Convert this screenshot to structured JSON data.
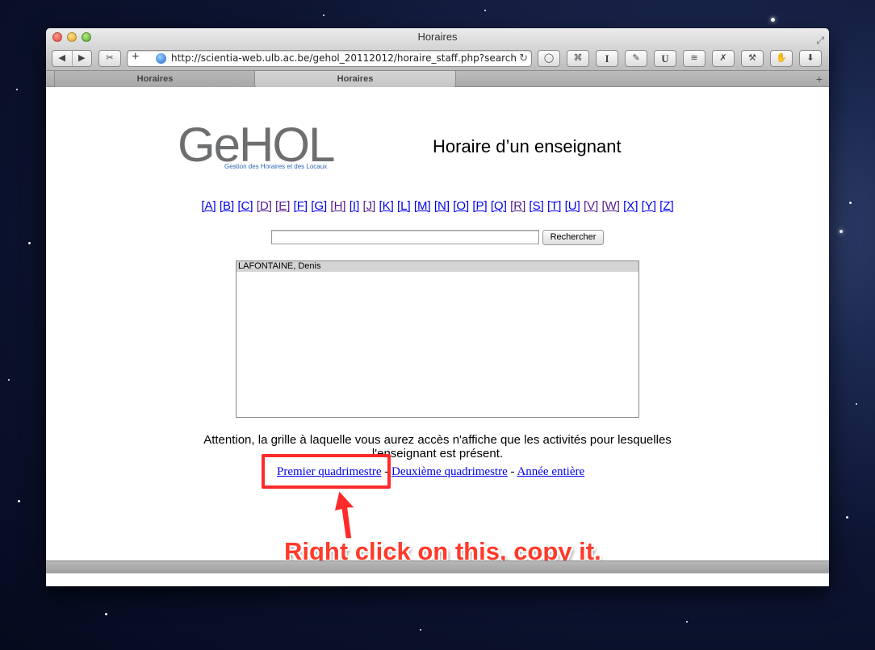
{
  "window": {
    "title": "Horaires"
  },
  "toolbar": {
    "url": "http://scientia-web.ulb.ac.be/gehol_20112012/horaire_staff.php?search",
    "extension_buttons": [
      "O",
      "rss",
      "I",
      "css",
      "U",
      "w",
      "x",
      "t",
      "h",
      "d"
    ]
  },
  "tabs": [
    {
      "label": "Horaires",
      "active": false
    },
    {
      "label": "Horaires",
      "active": true
    }
  ],
  "page": {
    "logo": {
      "word": "GeHOL",
      "subtitle": "Gestion des Horaires et des Locaux"
    },
    "title": "Horaire d’un enseignant",
    "letters": [
      "[A]",
      "[B]",
      "[C]",
      "[D]",
      "[E]",
      "[F]",
      "[G]",
      "[H]",
      "[I]",
      "[J]",
      "[K]",
      "[L]",
      "[M]",
      "[N]",
      "[O]",
      "[P]",
      "[Q]",
      "[R]",
      "[S]",
      "[T]",
      "[U]",
      "[V]",
      "[W]",
      "[X]",
      "[Y]",
      "[Z]"
    ],
    "visited_letters": [
      "[D]",
      "[E]",
      "[H]",
      "[J]",
      "[R]",
      "[V]",
      "[W]"
    ],
    "search": {
      "value": "",
      "button": "Rechercher"
    },
    "results": [
      "LAFONTAINE, Denis"
    ],
    "notice": "Attention, la grille à laquelle vous aurez accès n'affiche que les activités pour lesquelles l'enseignant est présent.",
    "links": {
      "first": "Premier quadrimestre",
      "second": "Deuxième quadrimestre",
      "full": "Année entière",
      "separator": "-"
    }
  },
  "annotation": {
    "text": "Right click on this, copy it.",
    "color": "#ff3a2a"
  }
}
